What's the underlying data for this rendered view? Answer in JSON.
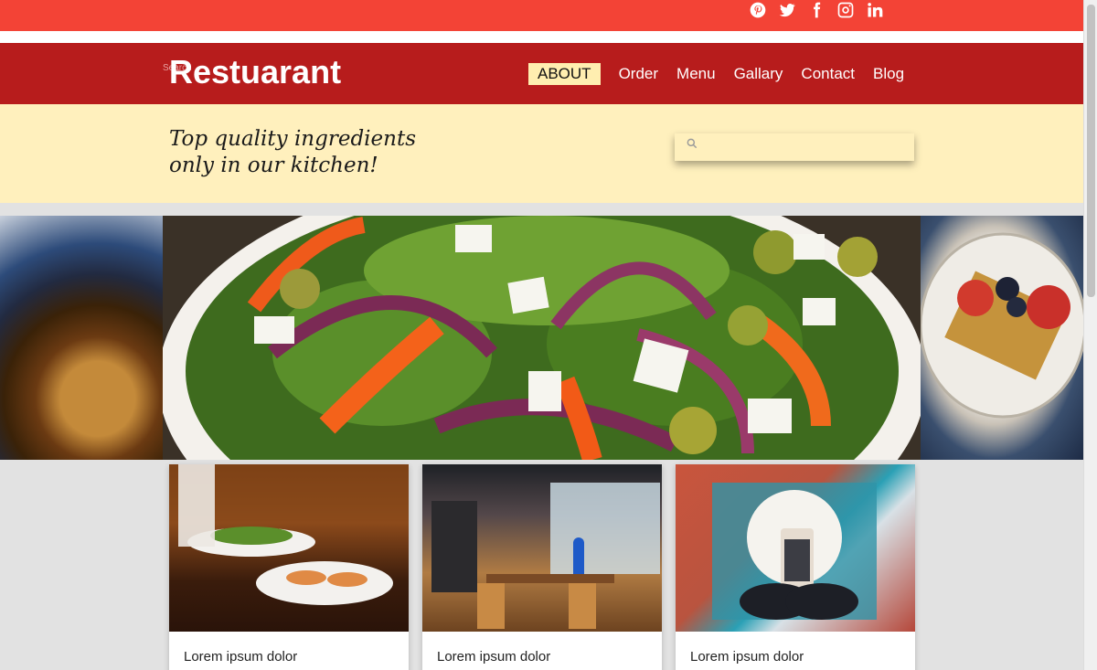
{
  "social": {
    "icons": [
      "pinterest-icon",
      "twitter-icon",
      "facebook-icon",
      "instagram-icon",
      "linkedin-icon"
    ]
  },
  "header": {
    "brand": "Restuarant",
    "tiny_label": "Search",
    "nav": [
      {
        "label": "ABOUT",
        "active": true
      },
      {
        "label": "Order"
      },
      {
        "label": "Menu"
      },
      {
        "label": "Gallary"
      },
      {
        "label": "Contact"
      },
      {
        "label": "Blog"
      }
    ]
  },
  "tagline": {
    "text": "Top quality ingredients only in our kitchen!"
  },
  "search": {
    "placeholder": "",
    "icon": "search-icon"
  },
  "cards": [
    {
      "caption": "Lorem ipsum dolor"
    },
    {
      "caption": "Lorem ipsum dolor"
    },
    {
      "caption": "Lorem ipsum dolor"
    }
  ],
  "colors": {
    "topbar": "#f34336",
    "header": "#b71c1c",
    "accent_band": "#fff0bd",
    "page_bg": "#e2e2e2"
  }
}
